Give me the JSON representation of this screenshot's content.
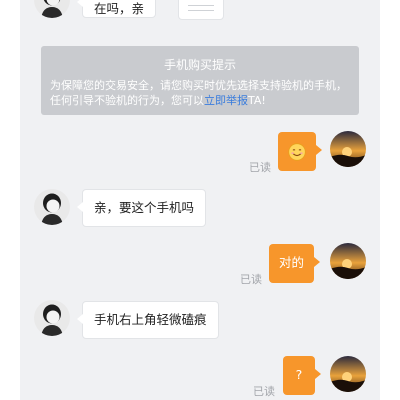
{
  "notice": {
    "title": "手机购买提示",
    "body_before": "为保障您的交易安全，请您购买时优先选择支持验机的手机，任何引导不验机的行为，您可以",
    "link": "立即举报",
    "body_after": "TA!"
  },
  "messages": [
    {
      "side": "in",
      "text": "在吗，亲"
    },
    {
      "side": "out",
      "emoji": "smiley-emoji",
      "text": "😊",
      "status": "已读"
    },
    {
      "side": "in",
      "text": "亲，要这个手机吗"
    },
    {
      "side": "out",
      "text": "对的",
      "status": "已读"
    },
    {
      "side": "in",
      "text": "手机右上角轻微磕痕"
    },
    {
      "side": "out",
      "text": "?",
      "status": "已读"
    }
  ],
  "colors": {
    "chat_background": "#f0f1f3",
    "outgoing_bubble": "#f7962b",
    "incoming_bubble": "#ffffff",
    "notice_background": "#c9cbcf",
    "link": "#3b7ddd",
    "read_status": "#a3a6ab"
  }
}
